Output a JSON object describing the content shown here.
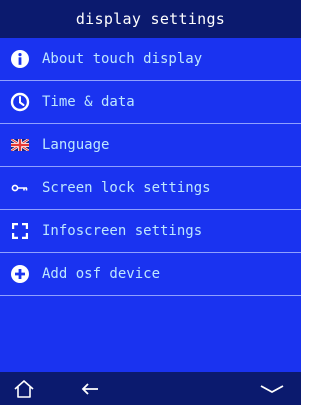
{
  "header": {
    "title": "display settings"
  },
  "menu": {
    "items": [
      {
        "label": "About touch display",
        "icon": "info-icon"
      },
      {
        "label": "Time & data",
        "icon": "clock-icon"
      },
      {
        "label": "Language",
        "icon": "uk-flag-icon"
      },
      {
        "label": "Screen lock settings",
        "icon": "key-icon"
      },
      {
        "label": "Infoscreen settings",
        "icon": "fullscreen-brackets-icon"
      },
      {
        "label": "Add osf device",
        "icon": "plus-circle-icon"
      }
    ]
  },
  "footer": {
    "home_icon": "home-icon",
    "back_icon": "back-arrow-icon",
    "scroll_icon": "chevron-down-icon"
  },
  "colors": {
    "background": "#1a33f0",
    "bar": "#0b1a6e",
    "label_text": "#bde7ff",
    "divider": "#8fa0ff",
    "icon": "#ffffff"
  }
}
